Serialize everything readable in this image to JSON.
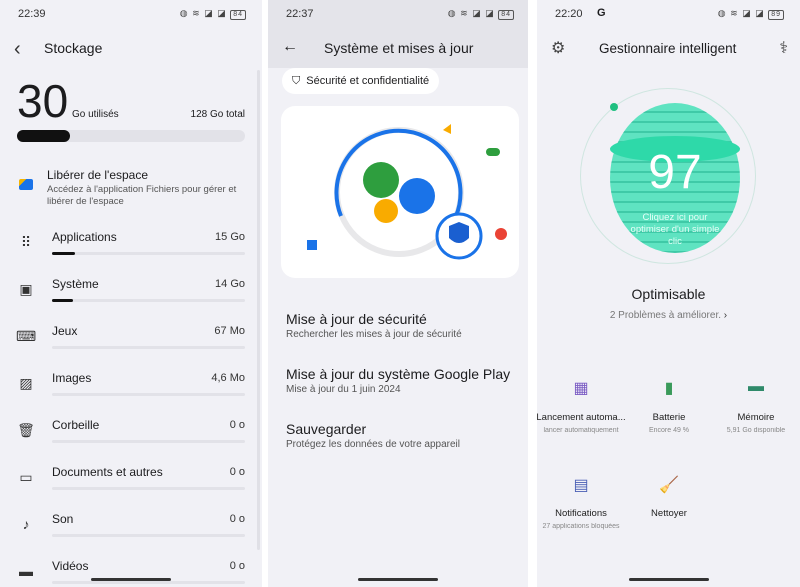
{
  "storage": {
    "status": {
      "time": "22:39",
      "battery": "84"
    },
    "title": "Stockage",
    "used": "30",
    "used_unit": "Go utilisés",
    "total": "128 Go total",
    "used_fraction": 0.234,
    "free_space": {
      "title": "Libérer de l'espace",
      "desc": "Accédez à l'application Fichiers pour gérer et libérer de l'espace"
    },
    "items": [
      {
        "label": "Applications",
        "value": "15 Go",
        "fraction": 0.117,
        "icon": "apps-grid-icon"
      },
      {
        "label": "Système",
        "value": "14 Go",
        "fraction": 0.109,
        "icon": "phone-download-icon"
      },
      {
        "label": "Jeux",
        "value": "67 Mo",
        "fraction": 0,
        "icon": "gamepad-icon"
      },
      {
        "label": "Images",
        "value": "4,6 Mo",
        "fraction": 0,
        "icon": "image-icon"
      },
      {
        "label": "Corbeille",
        "value": "0 o",
        "fraction": 0,
        "icon": "trash-icon"
      },
      {
        "label": "Documents et autres",
        "value": "0 o",
        "fraction": 0,
        "icon": "folder-icon"
      },
      {
        "label": "Son",
        "value": "0 o",
        "fraction": 0,
        "icon": "music-note-icon"
      },
      {
        "label": "Vidéos",
        "value": "0 o",
        "fraction": 0,
        "icon": "film-icon"
      }
    ]
  },
  "system": {
    "status": {
      "time": "22:37",
      "battery": "84"
    },
    "title": "Système et mises à jour",
    "chip": "Sécurité et confidentialité",
    "items": [
      {
        "title": "Mise à jour de sécurité",
        "sub": "Rechercher les mises à jour de sécurité"
      },
      {
        "title": "Mise à jour du système Google Play",
        "sub": "Mise à jour du 1 juin 2024"
      },
      {
        "title": "Sauvegarder",
        "sub": "Protégez les données de votre appareil"
      }
    ]
  },
  "manager": {
    "status": {
      "time": "22:20",
      "battery": "89"
    },
    "title": "Gestionnaire intelligent",
    "score": "97",
    "hint": "Cliquez ici pour optimiser d'un simple clic",
    "state": "Optimisable",
    "problems": "2 Problèmes à améliorer.",
    "accent": "#3fd9b0",
    "tiles": [
      {
        "label": "Lancement automa...",
        "sub": "lancer automatiquement",
        "icon": "auto-launch-icon",
        "color": "#7b5cc4"
      },
      {
        "label": "Batterie",
        "sub": "Encore 49 %",
        "icon": "battery-icon",
        "color": "#3a9a5a"
      },
      {
        "label": "Mémoire",
        "sub": "5,91 Go disponible",
        "icon": "memory-chip-icon",
        "color": "#2f8a6a"
      },
      {
        "label": "Notifications",
        "sub": "27 applications bloquées",
        "icon": "notification-bubble-icon",
        "color": "#4a5fb5"
      },
      {
        "label": "Nettoyer",
        "sub": "",
        "icon": "broom-icon",
        "color": "#e06a2a"
      }
    ]
  }
}
